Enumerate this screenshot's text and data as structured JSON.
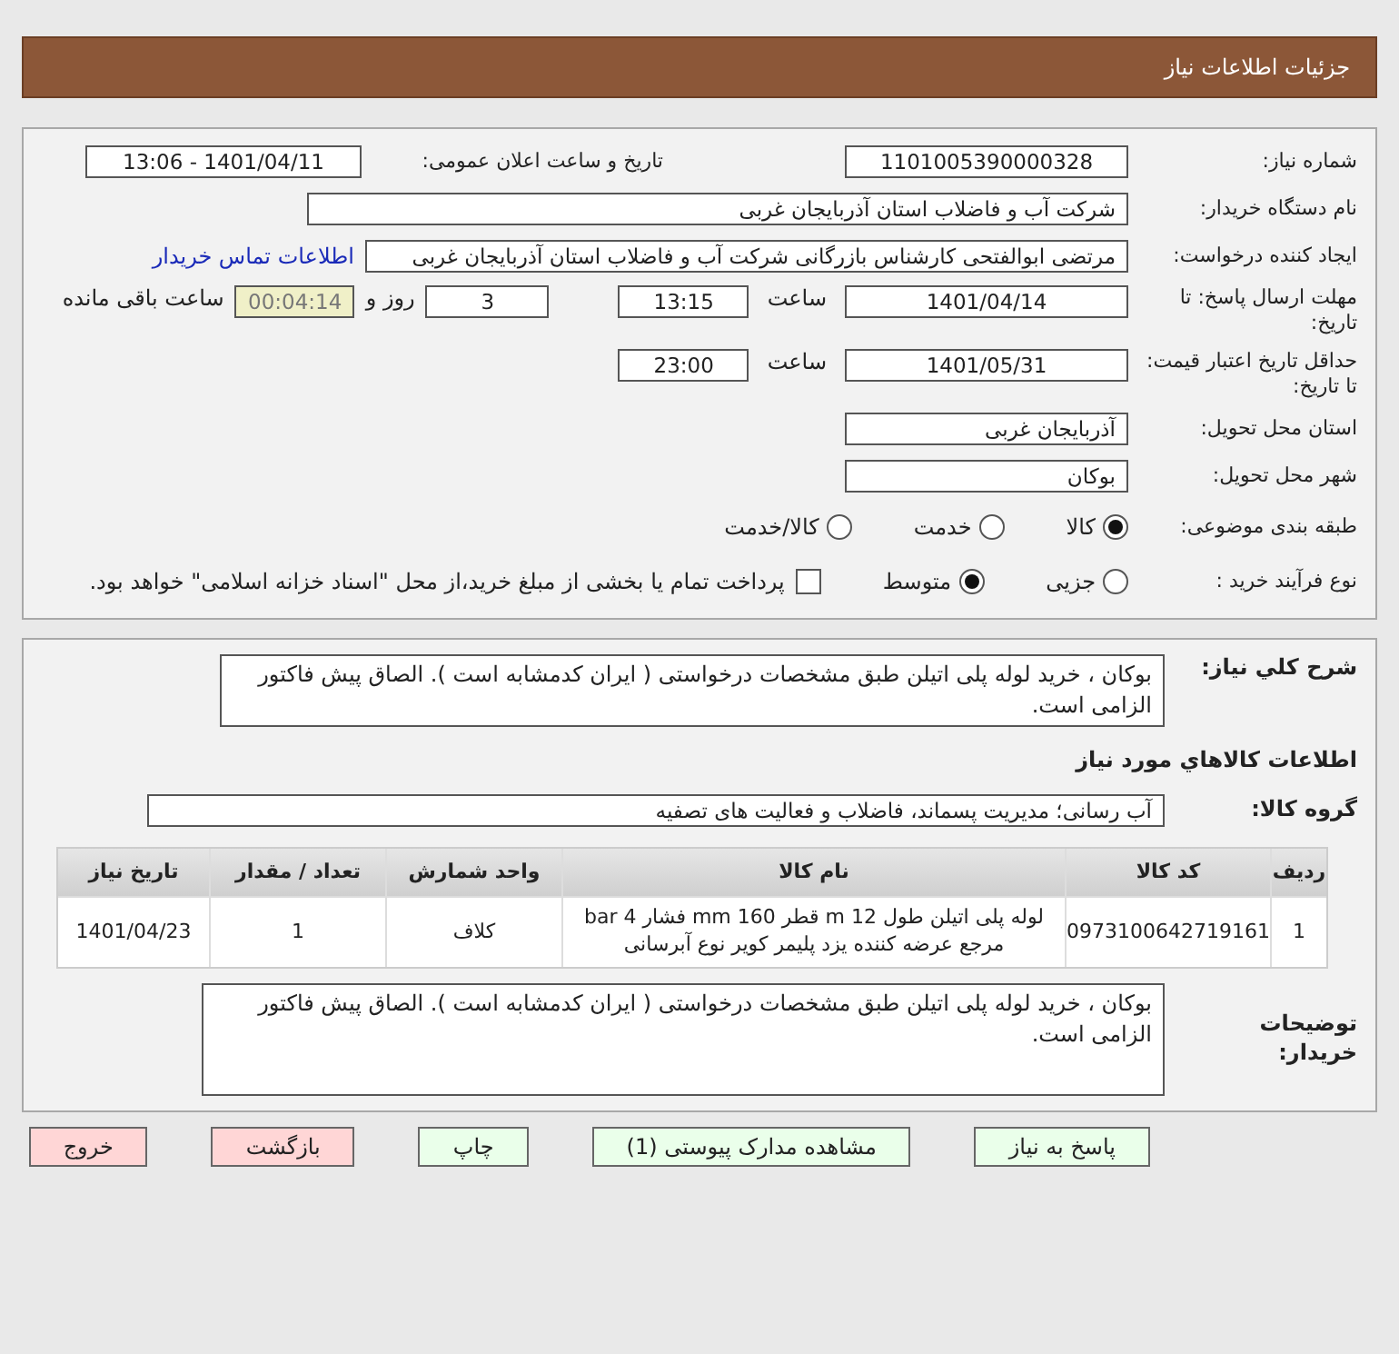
{
  "header": {
    "title": "جزئیات اطلاعات نیاز"
  },
  "need_number": {
    "label": "شماره نیاز:",
    "value": "1101005390000328"
  },
  "announce": {
    "label": "تاریخ و ساعت اعلان عمومی:",
    "value": "1401/04/11 - 13:06"
  },
  "buyer_org": {
    "label": "نام دستگاه خریدار:",
    "value": "شرکت آب و فاضلاب استان آذربایجان غربی"
  },
  "requester": {
    "label": "ایجاد کننده درخواست:",
    "value": "مرتضی ابوالفتحی کارشناس بازرگانی شرکت آب و فاضلاب استان آذربایجان غربی",
    "link": "اطلاعات تماس خریدار"
  },
  "deadline": {
    "label": "مهلت ارسال پاسخ: تا تاریخ:",
    "date": "1401/04/14",
    "time_label": "ساعت",
    "time": "13:15",
    "days": "3",
    "days_label": "روز و",
    "remaining": "00:04:14",
    "remaining_label": "ساعت باقی مانده"
  },
  "validity": {
    "label": "حداقل تاریخ اعتبار قیمت: تا تاریخ:",
    "date": "1401/05/31",
    "time_label": "ساعت",
    "time": "23:00"
  },
  "province": {
    "label": "استان محل تحویل:",
    "value": "آذربایجان غربی"
  },
  "city": {
    "label": "شهر محل تحویل:",
    "value": "بوکان"
  },
  "category": {
    "label": "طبقه بندی موضوعی:",
    "options": [
      {
        "label": "کالا",
        "selected": true
      },
      {
        "label": "خدمت",
        "selected": false
      },
      {
        "label": "کالا/خدمت",
        "selected": false
      }
    ]
  },
  "process": {
    "label": "نوع فرآیند خرید :",
    "options": [
      {
        "label": "جزیی",
        "selected": false
      },
      {
        "label": "متوسط",
        "selected": true
      }
    ],
    "payment": {
      "checked": false,
      "text": "پرداخت تمام یا بخشی از مبلغ خرید،از محل \"اسناد خزانه اسلامی\" خواهد بود."
    }
  },
  "description": {
    "label": "شرح کلي نياز:",
    "value": " بوکان ، خرید لوله پلی اتیلن طبق مشخصات درخواستی  ( ایران کدمشابه است ). الصاق پیش فاکتور الزامی است."
  },
  "goods_heading": "اطلاعات کالاهاي مورد نياز",
  "goods_group": {
    "label": "گروه کالا:",
    "value": "آب رسانی؛ مدیریت پسماند، فاضلاب و فعالیت های تصفیه"
  },
  "table": {
    "columns": [
      "ردیف",
      "کد کالا",
      "نام کالا",
      "واحد شمارش",
      "تعداد / مقدار",
      "تاریخ نیاز"
    ],
    "rows": [
      [
        "1",
        "0973100642719161",
        "لوله پلی اتیلن طول 12 m قطر 160 mm فشار 4 bar مرجع عرضه کننده یزد پلیمر کویر نوع آبرسانی",
        "کلاف",
        "1",
        "1401/04/23"
      ]
    ]
  },
  "buyer_notes": {
    "label": "توضیحات خریدار:",
    "value": " بوکان ، خرید لوله پلی اتیلن طبق مشخصات درخواستی  ( ایران کدمشابه است ). الصاق پیش فاکتور الزامی است."
  },
  "buttons": [
    {
      "label": "پاسخ به نیاز",
      "kind": "normal"
    },
    {
      "label": "مشاهده مدارک پیوستی (1)",
      "kind": "normal"
    },
    {
      "label": "چاپ",
      "kind": "normal"
    },
    {
      "label": "بازگشت",
      "kind": "danger"
    },
    {
      "label": "خروج",
      "kind": "danger"
    }
  ]
}
